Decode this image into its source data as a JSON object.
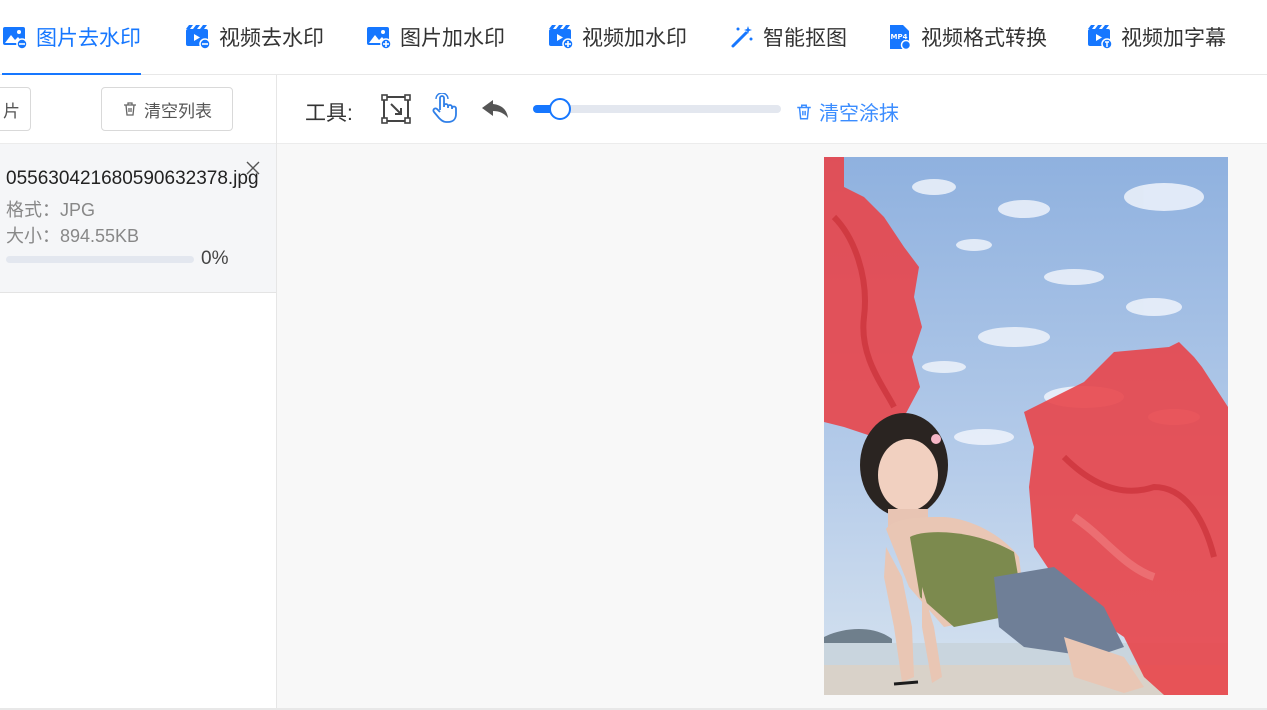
{
  "tabs": [
    {
      "label": "图片去水印",
      "icon": "image-remove-icon",
      "active": true
    },
    {
      "label": "视频去水印",
      "icon": "video-remove-icon",
      "active": false
    },
    {
      "label": "图片加水印",
      "icon": "image-add-icon",
      "active": false
    },
    {
      "label": "视频加水印",
      "icon": "video-add-icon",
      "active": false
    },
    {
      "label": "智能抠图",
      "icon": "magic-wand-icon",
      "active": false
    },
    {
      "label": "视频格式转换",
      "icon": "mp4-file-icon",
      "active": false
    },
    {
      "label": "视频加字幕",
      "icon": "video-subtitle-icon",
      "active": false
    }
  ],
  "left_panel": {
    "partial_button_label": "片",
    "clear_list_label": "清空列表",
    "file": {
      "name": "055630421680590632378.jpg",
      "format": "格式：JPG",
      "size": "大小：894.55KB",
      "progress": 0,
      "progress_text": "0%"
    }
  },
  "toolbar": {
    "label": "工具:",
    "tools": [
      "select-box-icon",
      "hand-pointer-icon",
      "undo-icon"
    ],
    "brush_size_fraction": 0.11,
    "clear_paint_label": "清空涂抹"
  },
  "colors": {
    "accent": "#1677ff",
    "mask_red": "#e8454a",
    "sky": "#a9c4e6"
  }
}
